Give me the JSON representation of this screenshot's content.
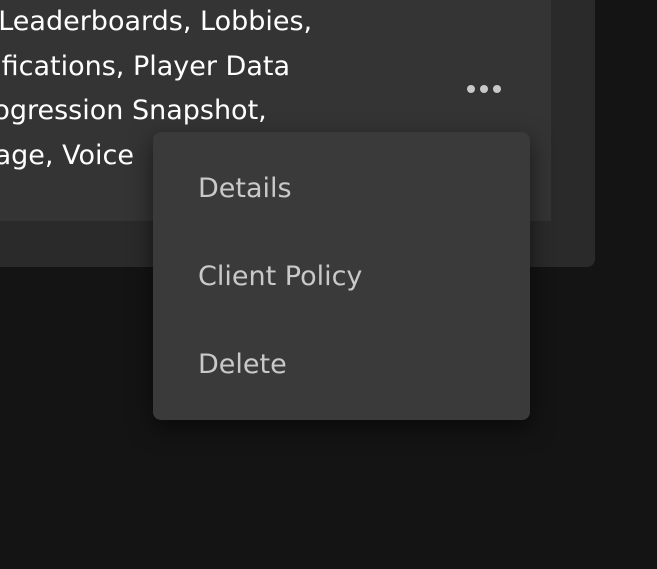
{
  "card": {
    "features_lines": [
      "s, Leaderboards, Lobbies,",
      "otifications, Player Data",
      "Progression Snapshot,",
      "orage, Voice"
    ]
  },
  "more_button": {
    "icon": "more-horizontal-icon"
  },
  "menu": {
    "items": [
      {
        "label": "Details"
      },
      {
        "label": "Client Policy"
      },
      {
        "label": "Delete"
      }
    ]
  }
}
